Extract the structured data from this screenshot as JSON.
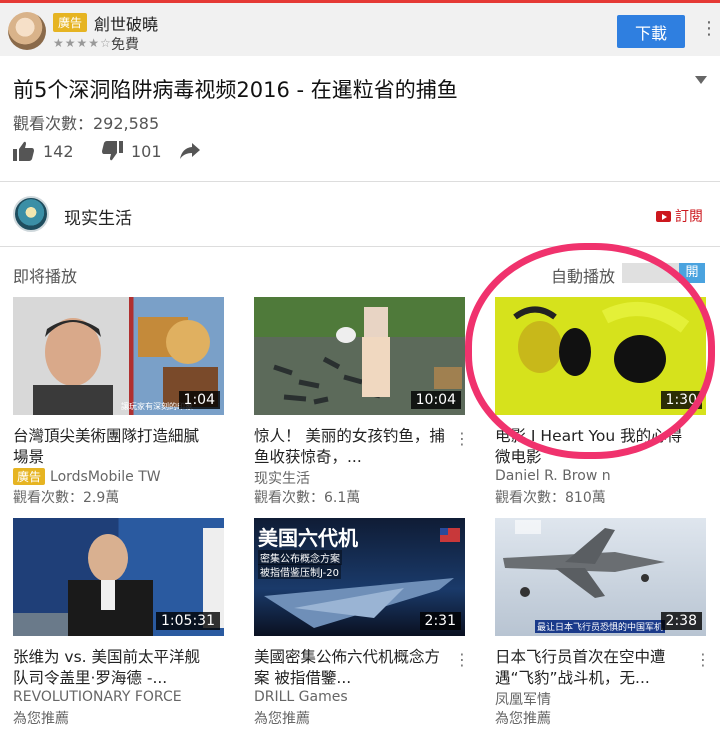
{
  "ad": {
    "badge": "廣告",
    "title": "創世破曉",
    "stars": "★★★★☆",
    "price": "免費",
    "download_label": "下載",
    "more_icon": "vertical-dots-icon"
  },
  "video": {
    "title": "前5个深洞陷阱病毒视频2016 - 在暹粒省的捕鱼",
    "views": "觀看次數：292,585",
    "likes": "142",
    "dislikes": "101"
  },
  "channel": {
    "name": "现实生活",
    "subscribe_label": "訂閱"
  },
  "upnext": {
    "label": "即将播放",
    "autoplay_label": "自動播放",
    "toggle_label": "開"
  },
  "cards": [
    {
      "title": "台灣頂尖美術團隊打造細膩場景",
      "channel": "LordsMobile TW",
      "ad_badge": "廣告",
      "meta": "觀看次數：2.9萬",
      "duration": "1:04",
      "thumb_caption": "讓玩家有深刻的印象"
    },
    {
      "title": "惊人！ 美丽的女孩钓鱼，捕鱼收获惊奇，...",
      "channel": "现实生活",
      "meta": "觀看次數：6.1萬",
      "duration": "10:04"
    },
    {
      "title": "电影 I Heart You 我的心得 微电影",
      "channel": "Daniel R. Brow n",
      "meta": "觀看次數：810萬",
      "duration": "1:30"
    },
    {
      "title": "张维为 vs. 美国前太平洋舰队司令盖里·罗海德 -...",
      "channel": "REVOLUTIONARY FORCE",
      "meta": "為您推薦",
      "duration": "1:05:31"
    },
    {
      "title": "美國密集公佈六代机概念方案 被指借鑒...",
      "channel": "DRILL Games",
      "meta": "為您推薦",
      "duration": "2:31",
      "thumb_title": "美国六代机",
      "thumb_sub1": "密集公布概念方案",
      "thumb_sub2": "被指借鉴压制J-20"
    },
    {
      "title": "日本飞行员首次在空中遭遇“飞豹”战斗机，无...",
      "channel": "凤凰军情",
      "meta": "為您推薦",
      "duration": "2:38",
      "thumb_caption": "最让日本飞行员恐惧的中国军机"
    }
  ]
}
